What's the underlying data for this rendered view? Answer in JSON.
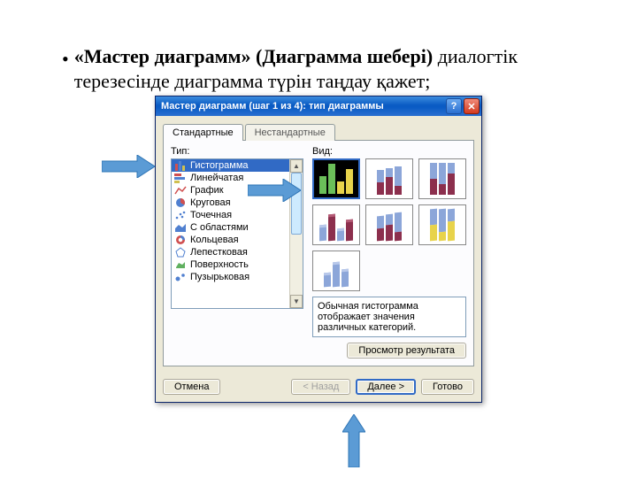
{
  "slide": {
    "bullet_bold": "«Мастер диаграмм» (Диаграмма шебері)",
    "bullet_rest": " диалогтік терезесінде диаграмма түрін таңдау қажет;"
  },
  "dialog": {
    "title": "Мастер диаграмм (шаг 1 из 4): тип диаграммы",
    "help_btn": "?",
    "close_btn": "✕",
    "tabs": {
      "standard": "Стандартные",
      "nonstandard": "Нестандартные"
    },
    "labels": {
      "type": "Тип:",
      "view": "Вид:"
    },
    "chart_types": [
      "Гистограмма",
      "Линейчатая",
      "График",
      "Круговая",
      "Точечная",
      "С областями",
      "Кольцевая",
      "Лепестковая",
      "Поверхность",
      "Пузырьковая"
    ],
    "description": "Обычная гистограмма отображает значения различных категорий.",
    "preview_button": "Просмотр результата",
    "buttons": {
      "cancel": "Отмена",
      "back": "< Назад",
      "next": "Далее >",
      "finish": "Готово"
    }
  },
  "colors": {
    "accent": "#316ac5",
    "arrow_fill": "#5b9bd5",
    "arrow_stroke": "#2e74b5"
  }
}
